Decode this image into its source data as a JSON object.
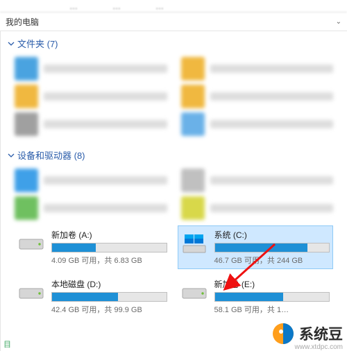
{
  "menubar": {
    "item1": "…",
    "item2": "…",
    "item3": "…"
  },
  "location": {
    "title": "我的电脑"
  },
  "sections": {
    "folders": {
      "label": "文件夹 (7)"
    },
    "drives": {
      "label": "设备和驱动器 (8)"
    }
  },
  "drives": [
    {
      "name": "新加卷 (A:)",
      "stats": "4.09 GB 可用，共 6.83 GB",
      "fill_pct": 38,
      "icon": "drive",
      "selected": false
    },
    {
      "name": "系统 (C:)",
      "stats": "46.7 GB 可用，共 244 GB",
      "fill_pct": 81,
      "icon": "windows-drive",
      "selected": true
    },
    {
      "name": "本地磁盘 (D:)",
      "stats": "42.4 GB 可用，共 99.9 GB",
      "fill_pct": 58,
      "icon": "drive",
      "selected": false
    },
    {
      "name": "新加卷 (E:)",
      "stats": "58.1 GB 可用，共 1…",
      "fill_pct": 60,
      "icon": "drive",
      "selected": false
    }
  ],
  "status": {
    "label": "目"
  },
  "brand": {
    "name": "系统豆",
    "url": "www.xtdpc.com"
  },
  "blur_icons": {
    "folders": [
      "#4aa3e0",
      "#f0b840",
      "#f0b840",
      "#f0b840",
      "#a0a0a0",
      "#6ab1e8"
    ],
    "devices": [
      "#3fa0e8",
      "#c0c0c0",
      "#6fc060",
      "#d8d84a"
    ]
  }
}
